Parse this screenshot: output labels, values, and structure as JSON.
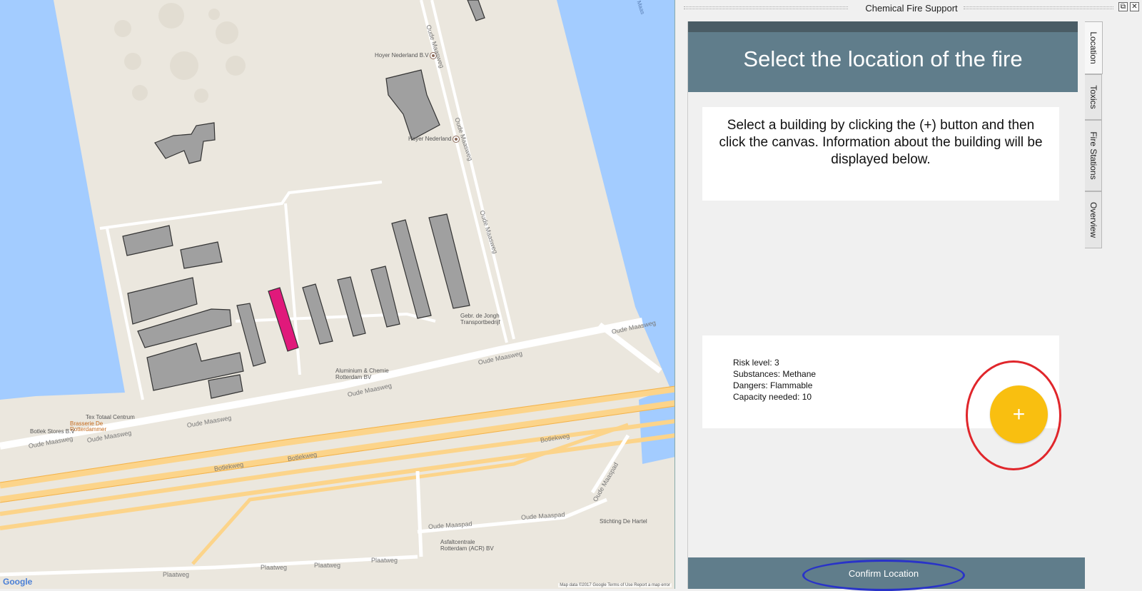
{
  "map": {
    "labels": {
      "hoyer1": "Hoyer Nederland B.V",
      "hoyer2": "Hoyer Nederland",
      "gebr": "Gebr. de Jongh\nTransportbedrijf",
      "aluminium": "Aluminium & Chemie\nRotterdam BV",
      "tex": "Tex Totaal Centrum",
      "brasserie": "Brasserie De\nRotterdammer",
      "botlek": "Botlek Stores B.V",
      "asfalt": "Asfaltcentrale\nRotterdam (ACR) BV",
      "stichting": "Stichting De Hartel",
      "maas": "Maas"
    },
    "roads": {
      "oude_maasweg": "Oude Maasweg",
      "oude_maasweg_v": "Oude Maasweg",
      "oude_maasweg_v2": "Oude Maasweg",
      "oude_maasweg_b1": "Oude Maasweg",
      "oude_maasweg_b2": "Oude Maasweg",
      "oude_maasweg_b3": "Oude Maasweg",
      "oude_maasweg_b4": "Oude Maasweg",
      "oude_maasweg_b5": "Oude Maasweg",
      "oude_maasweg_b6": "Oude Maasweg",
      "botlekweg1": "Botlekweg",
      "botlekweg2": "Botlekweg",
      "botlekweg3": "Botlekweg",
      "oude_maaspad1": "Oude Maaspad",
      "oude_maaspad2": "Oude Maaspad",
      "oude_maaspad3": "Oude Maaspad",
      "plaatweg1": "Plaatweg",
      "plaatweg2": "Plaatweg",
      "plaatweg3": "Plaatweg",
      "plaatweg4": "Plaatweg"
    },
    "google": "Google",
    "attribution": "Map data ©2017 Google   Terms of Use   Report a map error"
  },
  "dock": {
    "title": "Chemical Fire Support"
  },
  "panel": {
    "header": "Select the location of the fire",
    "instruction": "Select a building by clicking the (+) button and then click the canvas. Information about the building will be displayed below.",
    "info": {
      "risk": "Risk level: 3",
      "substances": "Substances: Methane",
      "dangers": "Dangers: Flammable",
      "capacity": "Capacity needed: 10"
    },
    "add_button": "+",
    "confirm": "Confirm Location"
  },
  "tabs": [
    "Location",
    "Toxics",
    "Fire Stations",
    "Overview"
  ],
  "colors": {
    "header": "#607d8b",
    "fab": "#f9bf10",
    "selected_building": "#e0197b",
    "water": "#a3ccff"
  }
}
